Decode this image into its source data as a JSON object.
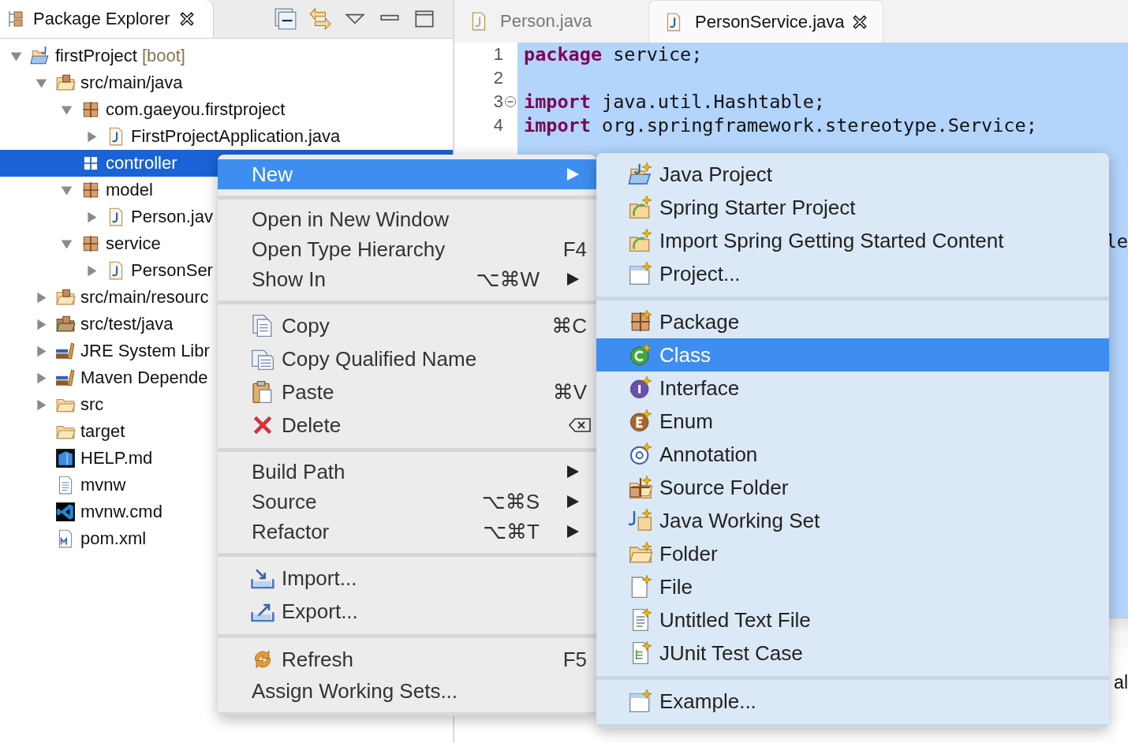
{
  "explorer": {
    "tab": {
      "title": "Package Explorer",
      "selected": true
    },
    "tree": [
      {
        "label": "firstProject",
        "decoration": "[boot]",
        "kind": "project",
        "expanded": true,
        "selected": false,
        "children": [
          {
            "label": "src/main/java",
            "kind": "source-folder",
            "expanded": true,
            "selected": false,
            "children": [
              {
                "label": "com.gaeyou.firstproject",
                "kind": "package",
                "expanded": true,
                "selected": false,
                "children": [
                  {
                    "label": "FirstProjectApplication.java",
                    "kind": "java-file",
                    "expanded": false,
                    "selected": false
                  }
                ]
              },
              {
                "label": "controller",
                "kind": "package",
                "selected": true
              },
              {
                "label": "model",
                "kind": "package",
                "expanded": true,
                "selected": false,
                "children": [
                  {
                    "label": "Person.jav",
                    "kind": "java-file",
                    "expanded": false,
                    "selected": false
                  }
                ]
              },
              {
                "label": "service",
                "kind": "package",
                "expanded": true,
                "selected": false,
                "children": [
                  {
                    "label": "PersonSer",
                    "kind": "java-file",
                    "expanded": false,
                    "selected": false
                  }
                ]
              }
            ]
          },
          {
            "label": "src/main/resourc",
            "kind": "source-folder",
            "expanded": false,
            "selected": false
          },
          {
            "label": "src/test/java",
            "kind": "test-folder",
            "expanded": false,
            "selected": false
          },
          {
            "label": "JRE System Libr",
            "kind": "library",
            "expanded": false,
            "selected": false
          },
          {
            "label": "Maven Depende",
            "kind": "library",
            "expanded": false,
            "selected": false
          },
          {
            "label": "src",
            "kind": "folder",
            "expanded": false,
            "selected": false
          },
          {
            "label": "target",
            "kind": "folder",
            "selected": false
          },
          {
            "label": "HELP.md",
            "kind": "markdown",
            "selected": false
          },
          {
            "label": "mvnw",
            "kind": "text-file",
            "selected": false
          },
          {
            "label": "mvnw.cmd",
            "kind": "cmd-file",
            "selected": false
          },
          {
            "label": "pom.xml",
            "kind": "maven-file",
            "selected": false
          }
        ]
      }
    ]
  },
  "editor": {
    "tabs": [
      {
        "title": "Person.java",
        "selected": false
      },
      {
        "title": "PersonService.java",
        "selected": true
      }
    ],
    "lines": [
      {
        "number": "1",
        "collapsible": false,
        "tokens": [
          {
            "text": "package",
            "keyword": true
          },
          {
            "text": " service;",
            "keyword": false
          }
        ]
      },
      {
        "number": "2",
        "collapsible": false
      },
      {
        "number": "3",
        "collapsible": true,
        "tokens": [
          {
            "text": "import",
            "keyword": true
          },
          {
            "text": " java.util.Hashtable;",
            "keyword": false
          }
        ]
      },
      {
        "number": "4",
        "collapsible": false,
        "tokens": [
          {
            "text": "import",
            "keyword": true
          },
          {
            "text": " org.springframework.stereotype.Service;",
            "keyword": false
          }
        ]
      }
    ],
    "covered_fragment": "le",
    "bottom_panel": {
      "text": "al"
    }
  },
  "context_menu": {
    "sections": [
      [
        {
          "label": "New",
          "submenu": true,
          "selected": true
        }
      ],
      [
        {
          "label": "Open in New Window",
          "submenu": false,
          "selected": false
        },
        {
          "label": "Open Type Hierarchy",
          "shortcut": "F4",
          "submenu": false,
          "selected": false
        },
        {
          "label": "Show In",
          "shortcut": "⌥⌘W",
          "submenu": true,
          "selected": false
        }
      ],
      [
        {
          "label": "Copy",
          "kind": "copy",
          "shortcut": "⌘C",
          "submenu": false,
          "selected": false
        },
        {
          "label": "Copy Qualified Name",
          "kind": "copy-name",
          "submenu": false,
          "selected": false
        },
        {
          "label": "Paste",
          "kind": "paste",
          "shortcut": "⌘V",
          "submenu": false,
          "selected": false
        },
        {
          "label": "Delete",
          "kind": "delete",
          "submenu": false,
          "selected": false
        }
      ],
      [
        {
          "label": "Build Path",
          "submenu": true,
          "selected": false
        },
        {
          "label": "Source",
          "shortcut": "⌥⌘S",
          "submenu": true,
          "selected": false
        },
        {
          "label": "Refactor",
          "shortcut": "⌥⌘T",
          "submenu": true,
          "selected": false
        }
      ],
      [
        {
          "label": "Import...",
          "kind": "import",
          "submenu": false,
          "selected": false
        },
        {
          "label": "Export...",
          "kind": "export",
          "submenu": false,
          "selected": false
        }
      ],
      [
        {
          "label": "Refresh",
          "kind": "refresh",
          "shortcut": "F5",
          "submenu": false,
          "selected": false
        },
        {
          "label": "Assign Working Sets...",
          "submenu": false,
          "selected": false
        }
      ]
    ]
  },
  "new_submenu": {
    "sections": [
      [
        {
          "label": "Java Project",
          "kind": "java-project",
          "selected": false
        },
        {
          "label": "Spring Starter Project",
          "kind": "spring-project",
          "selected": false
        },
        {
          "label": "Import Spring Getting Started Content",
          "kind": "spring-project",
          "selected": false
        },
        {
          "label": "Project...",
          "kind": "project-wizard",
          "selected": false
        }
      ],
      [
        {
          "label": "Package",
          "kind": "package",
          "selected": false
        },
        {
          "label": "Class",
          "kind": "class",
          "selected": true
        },
        {
          "label": "Interface",
          "kind": "interface",
          "selected": false
        },
        {
          "label": "Enum",
          "kind": "enum",
          "selected": false
        },
        {
          "label": "Annotation",
          "kind": "annotation",
          "selected": false
        },
        {
          "label": "Source Folder",
          "kind": "source-folder",
          "selected": false
        },
        {
          "label": "Java Working Set",
          "kind": "working-set",
          "selected": false
        },
        {
          "label": "Folder",
          "kind": "folder",
          "selected": false
        },
        {
          "label": "File",
          "kind": "file",
          "selected": false
        },
        {
          "label": "Untitled Text File",
          "kind": "text-file",
          "selected": false
        },
        {
          "label": "JUnit Test Case",
          "kind": "junit",
          "selected": false
        }
      ],
      [
        {
          "label": "Example...",
          "kind": "project-wizard",
          "selected": false
        }
      ]
    ]
  }
}
